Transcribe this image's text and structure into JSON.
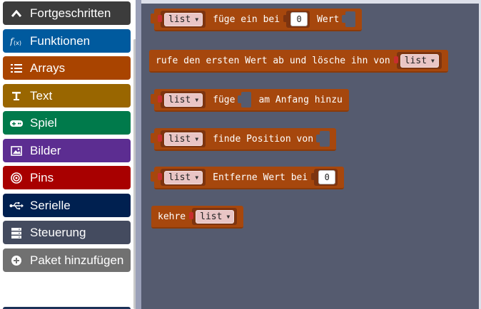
{
  "toolbox": {
    "categories": [
      {
        "label": "Fortgeschritten",
        "icon": "chevron-up-icon",
        "color": "#3c3c3c"
      },
      {
        "label": "Funktionen",
        "icon": "function-icon",
        "color": "#005a9e"
      },
      {
        "label": "Arrays",
        "icon": "list-icon",
        "color": "#a94400"
      },
      {
        "label": "Text",
        "icon": "text-icon",
        "color": "#996600"
      },
      {
        "label": "Spiel",
        "icon": "gamepad-icon",
        "color": "#007a4b"
      },
      {
        "label": "Bilder",
        "icon": "image-icon",
        "color": "#5c2d91"
      },
      {
        "label": "Pins",
        "icon": "pin-icon",
        "color": "#a80000"
      },
      {
        "label": "Serielle",
        "icon": "usb-icon",
        "color": "#002050"
      },
      {
        "label": "Steuerung",
        "icon": "control-icon",
        "color": "#444b5f"
      },
      {
        "label": "Paket hinzufügen",
        "icon": "plus-circle-icon",
        "color": "#717171"
      }
    ]
  },
  "flyout": {
    "block_color": "#a6470d",
    "variable_name": "list",
    "blocks": [
      {
        "id": "insert-at",
        "parts": [
          "füge ein bei",
          "Wert"
        ],
        "number": "0"
      },
      {
        "id": "remove-first",
        "text": "rufe den ersten Wert ab und lösche ihn von"
      },
      {
        "id": "insert-front",
        "parts": [
          "füge",
          "am Anfang hinzu"
        ]
      },
      {
        "id": "find-index",
        "text": "finde Position von"
      },
      {
        "id": "remove-at",
        "text": "Entferne Wert bei",
        "number": "0"
      },
      {
        "id": "return",
        "text": "kehre"
      }
    ]
  }
}
